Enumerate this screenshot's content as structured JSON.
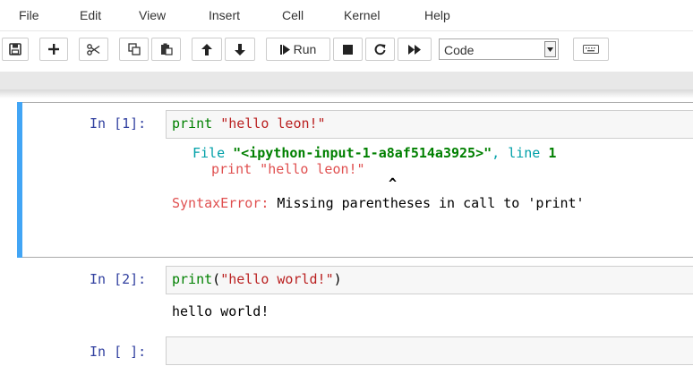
{
  "menu": [
    "File",
    "Edit",
    "View",
    "Insert",
    "Cell",
    "Kernel",
    "Help"
  ],
  "toolbar": {
    "run_label": "Run",
    "cell_type": "Code",
    "icons": [
      "save-icon",
      "plus-icon",
      "cut-icon",
      "copy-icon",
      "paste-icon",
      "arrow-up-icon",
      "arrow-down-icon",
      "run-icon",
      "stop-icon",
      "restart-icon",
      "fast-forward-icon",
      "chevron-down-icon",
      "keyboard-icon"
    ]
  },
  "cells": [
    {
      "prompt": "In [1]:",
      "code": {
        "fn": "print",
        "space": " ",
        "str": "\"hello leon!\""
      },
      "traceback": {
        "line1_pre": "File ",
        "line1_file": "\"<ipython-input-1-a8af514a3925>\"",
        "line1_mid": ", line ",
        "line1_num": "1",
        "line2": "print \"hello leon!\"",
        "caret": "^",
        "error_name": "SyntaxError:",
        "error_msg": " Missing parentheses in call to 'print'"
      }
    },
    {
      "prompt": "In [2]:",
      "code": {
        "fn": "print",
        "open": "(",
        "str": "\"hello world!\"",
        "close": ")"
      },
      "output": "hello world!"
    },
    {
      "prompt": "In [ ]:"
    }
  ],
  "colors": {
    "selected_bar": "#42a5f5",
    "prompt": "#303f9f",
    "keyword": "#008000",
    "string": "#ba2121"
  }
}
